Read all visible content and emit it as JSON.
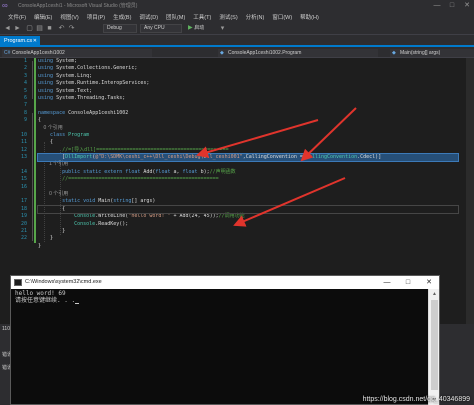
{
  "titlebar": {
    "title": "ConsoleApp1ceshi1 - Microsoft Visual Studio (管理员)",
    "minimize": "—",
    "maximize": "□",
    "close": "✕"
  },
  "menu": [
    "文件(F)",
    "编辑(E)",
    "视图(V)",
    "项目(P)",
    "生成(B)",
    "调试(D)",
    "团队(M)",
    "工具(T)",
    "测试(S)",
    "分析(N)",
    "窗口(W)",
    "帮助(H)"
  ],
  "toolbar": {
    "config": "Debug",
    "platform": "Any CPU",
    "run_label": "启动"
  },
  "tab": {
    "label": "Program.cs",
    "close": "✕"
  },
  "navbar": {
    "project": "ConsoleApp1ceshi1002",
    "class": "ConsoleApp1ceshi1002.Program",
    "member": "Main(string[] args)"
  },
  "editor": {
    "line_numbers": [
      "1",
      "2",
      "3",
      "4",
      "5",
      "6",
      "7",
      "8",
      "9",
      "10",
      "11",
      "12",
      "13",
      "14",
      "15",
      "16",
      "17",
      "18",
      "19",
      "20",
      "21",
      "22"
    ],
    "lines": [
      [
        [
          "kw",
          "using "
        ],
        [
          "pl",
          "System;"
        ]
      ],
      [
        [
          "kw",
          "using "
        ],
        [
          "pl",
          "System.Collections.Generic;"
        ]
      ],
      [
        [
          "kw",
          "using "
        ],
        [
          "pl",
          "System.Linq;"
        ]
      ],
      [
        [
          "kw",
          "using "
        ],
        [
          "pl",
          "System.Runtime.InteropServices;"
        ]
      ],
      [
        [
          "kw",
          "using "
        ],
        [
          "pl",
          "System.Text;"
        ]
      ],
      [
        [
          "kw",
          "using "
        ],
        [
          "pl",
          "System.Threading.Tasks;"
        ]
      ],
      [],
      [
        [
          "kw",
          "namespace "
        ],
        [
          "pl",
          "ConsoleApp1ceshi1002"
        ]
      ],
      [
        [
          "pl",
          "{"
        ]
      ],
      [
        [
          "ref",
          "    0 个引用"
        ]
      ],
      [
        [
          "pl",
          "    "
        ],
        [
          "kw",
          "class "
        ],
        [
          "ty",
          "Program"
        ]
      ],
      [
        [
          "pl",
          "    {"
        ]
      ],
      [
        [
          "cm",
          "        //=[导入dll]============================================"
        ]
      ],
      [
        [
          "pl",
          "        ["
        ],
        [
          "ty",
          "DllImport"
        ],
        [
          "pl",
          "("
        ],
        [
          "st",
          "@\"D:\\SDMK\\ceshi_c++\\Dll_ceshi\\Debug\\Dll_ceshi001\""
        ],
        [
          "pl",
          ",CallingConvention = "
        ],
        [
          "ty",
          "CallingConvention"
        ],
        [
          "pl",
          ".Cdecl)]"
        ]
      ],
      [
        [
          "ref",
          "        1 个引用"
        ]
      ],
      [
        [
          "pl",
          "        "
        ],
        [
          "kw",
          "public static extern float "
        ],
        [
          "pl",
          "Add("
        ],
        [
          "kw",
          "float "
        ],
        [
          "pl",
          "a, "
        ],
        [
          "kw",
          "float "
        ],
        [
          "pl",
          "b);"
        ],
        [
          "cm",
          "//声明函数"
        ]
      ],
      [
        [
          "cm",
          "        //=================================================="
        ]
      ],
      [],
      [
        [
          "ref",
          "        0 个引用"
        ]
      ],
      [
        [
          "pl",
          "        "
        ],
        [
          "kw",
          "static void "
        ],
        [
          "pl",
          "Main("
        ],
        [
          "kw",
          "string"
        ],
        [
          "pl",
          "[] args)"
        ]
      ],
      [
        [
          "pl",
          "        {"
        ]
      ],
      [
        [
          "pl",
          "            "
        ],
        [
          "ty",
          "Console"
        ],
        [
          "pl",
          ".WriteLine("
        ],
        [
          "st",
          "\"hello word! \""
        ],
        [
          "pl",
          " + Add(24, 45));"
        ],
        [
          "cm",
          "//调用功能"
        ]
      ],
      [
        [
          "pl",
          "            "
        ],
        [
          "ty",
          "Console"
        ],
        [
          "pl",
          ".ReadKey();"
        ]
      ],
      [
        [
          "pl",
          "        }"
        ]
      ],
      [
        [
          "pl",
          "    }"
        ]
      ],
      [
        [
          "pl",
          "}"
        ]
      ]
    ]
  },
  "bottom_panel": {
    "label_a": "110",
    "label_b": "错误",
    "label_c": "错误"
  },
  "console": {
    "title": "C:\\Windows\\system32\\cmd.exe",
    "lines": [
      "hello word! 69",
      "请按任意键继续. . ."
    ],
    "minimize": "—",
    "maximize": "□",
    "close": "✕",
    "scroll_up": "▲",
    "scroll_down": "▼"
  },
  "watermark": "https://blog.csdn.net/qq_40346899",
  "colors": {
    "accent": "#007acc",
    "arrow": "#e0342c"
  }
}
